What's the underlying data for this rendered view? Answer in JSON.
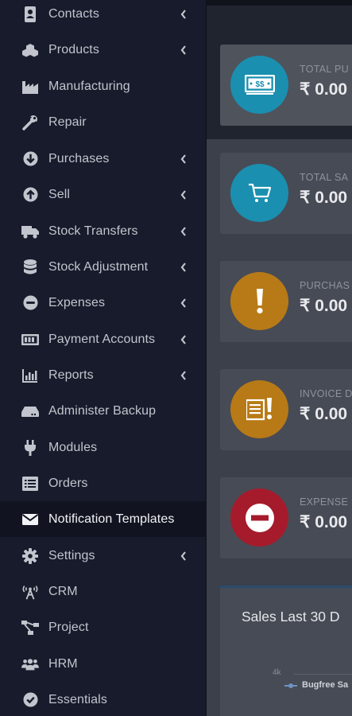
{
  "sidebar": {
    "items": [
      {
        "label": "Contacts",
        "icon": "address-book-icon"
      },
      {
        "label": "Products",
        "icon": "cubes-icon"
      },
      {
        "label": "Manufacturing",
        "icon": "industry-icon"
      },
      {
        "label": "Repair",
        "icon": "wrench-icon"
      },
      {
        "label": "Purchases",
        "icon": "arrow-circle-down-icon"
      },
      {
        "label": "Sell",
        "icon": "arrow-circle-up-icon"
      },
      {
        "label": "Stock Transfers",
        "icon": "truck-icon"
      },
      {
        "label": "Stock Adjustment",
        "icon": "database-icon"
      },
      {
        "label": "Expenses",
        "icon": "minus-circle-icon"
      },
      {
        "label": "Payment Accounts",
        "icon": "money-bill-icon"
      },
      {
        "label": "Reports",
        "icon": "bar-chart-icon"
      },
      {
        "label": "Administer Backup",
        "icon": "hdd-icon"
      },
      {
        "label": "Modules",
        "icon": "plug-icon"
      },
      {
        "label": "Orders",
        "icon": "list-alt-icon"
      },
      {
        "label": "Notification Templates",
        "icon": "envelope-icon"
      },
      {
        "label": "Settings",
        "icon": "cog-icon"
      },
      {
        "label": "CRM",
        "icon": "broadcast-tower-icon"
      },
      {
        "label": "Project",
        "icon": "project-diagram-icon"
      },
      {
        "label": "HRM",
        "icon": "users-icon"
      },
      {
        "label": "Essentials",
        "icon": "check-circle-icon"
      }
    ]
  },
  "cards": [
    {
      "label": "TOTAL PU",
      "value": "₹ 0.00",
      "color": "#1a8fb0",
      "icon": "money-bill-icon"
    },
    {
      "label": "TOTAL SA",
      "value": "₹ 0.00",
      "color": "#1a8fb0",
      "icon": "shopping-cart-icon"
    },
    {
      "label": "PURCHAS",
      "value": "₹ 0.00",
      "color": "#b87a16",
      "icon": "exclamation-icon"
    },
    {
      "label": "INVOICE D",
      "value": "₹ 0.00",
      "color": "#b87a16",
      "icon": "invoice-alert-icon"
    },
    {
      "label": "EXPENSE",
      "value": "₹ 0.00",
      "color": "#a51b2c",
      "icon": "minus-circle-icon"
    }
  ],
  "sales_chart": {
    "title": "Sales Last 30 D",
    "y_tick": "4k",
    "legend_label": "Bugfree Sa",
    "series_color": "#6f93c4"
  }
}
